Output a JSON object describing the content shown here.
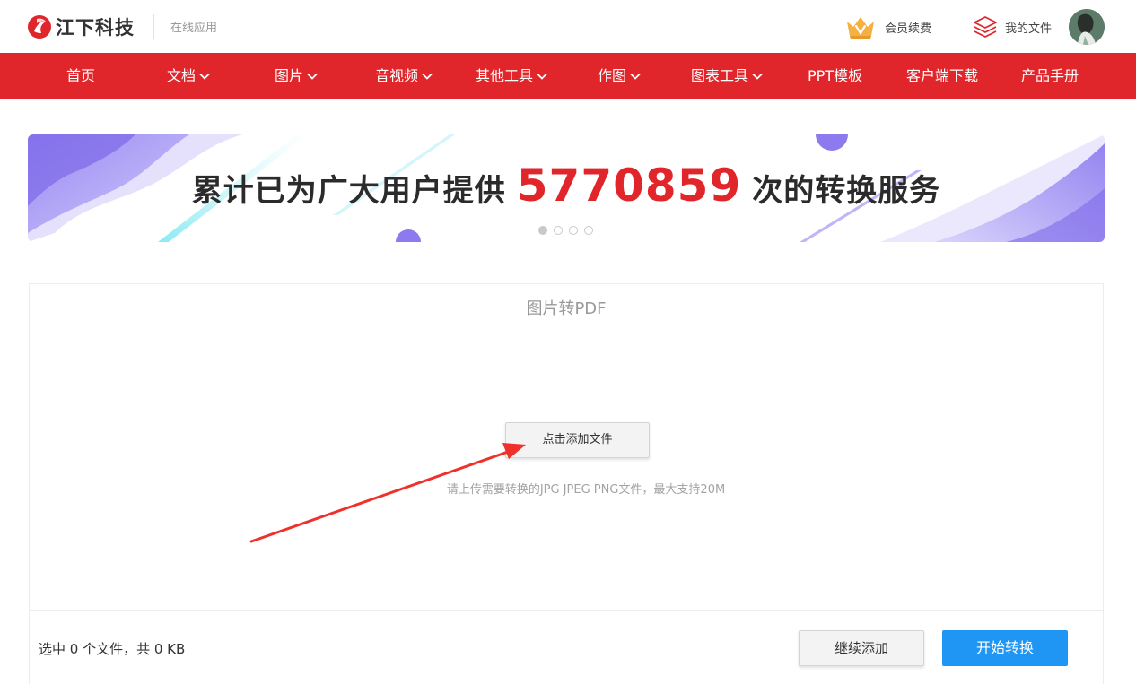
{
  "header": {
    "brand_name": "江下科技",
    "subtitle": "在线应用",
    "vip_label": "会员续费",
    "files_label": "我的文件"
  },
  "nav": {
    "items": [
      {
        "label": "首页",
        "has_dropdown": false
      },
      {
        "label": "文档",
        "has_dropdown": true
      },
      {
        "label": "图片",
        "has_dropdown": true
      },
      {
        "label": "音视频",
        "has_dropdown": true
      },
      {
        "label": "其他工具",
        "has_dropdown": true
      },
      {
        "label": "作图",
        "has_dropdown": true
      },
      {
        "label": "图表工具",
        "has_dropdown": true
      },
      {
        "label": "PPT模板",
        "has_dropdown": false
      },
      {
        "label": "客户端下载",
        "has_dropdown": false
      },
      {
        "label": "产品手册",
        "has_dropdown": false
      }
    ]
  },
  "banner": {
    "prefix": "累计已为广大用户提供",
    "count": "5770859",
    "suffix": "次的转换服务",
    "slide_count": 4,
    "active_slide": 1
  },
  "converter": {
    "title": "图片转PDF",
    "add_button": "点击添加文件",
    "hint": "请上传需要转换的JPG JPEG PNG文件，最大支持20M",
    "status": "选中 0 个文件，共 0 KB",
    "continue_button": "继续添加",
    "start_button": "开始转换"
  },
  "colors": {
    "brand_red": "#e0262b",
    "primary_blue": "#1f96f3",
    "annotation_arrow": "#f0302a"
  },
  "icons": {
    "logo": "jiangxia-logo-icon",
    "vip": "crown-icon",
    "files": "layers-icon",
    "nav_dropdown": "chevron-down-icon"
  }
}
